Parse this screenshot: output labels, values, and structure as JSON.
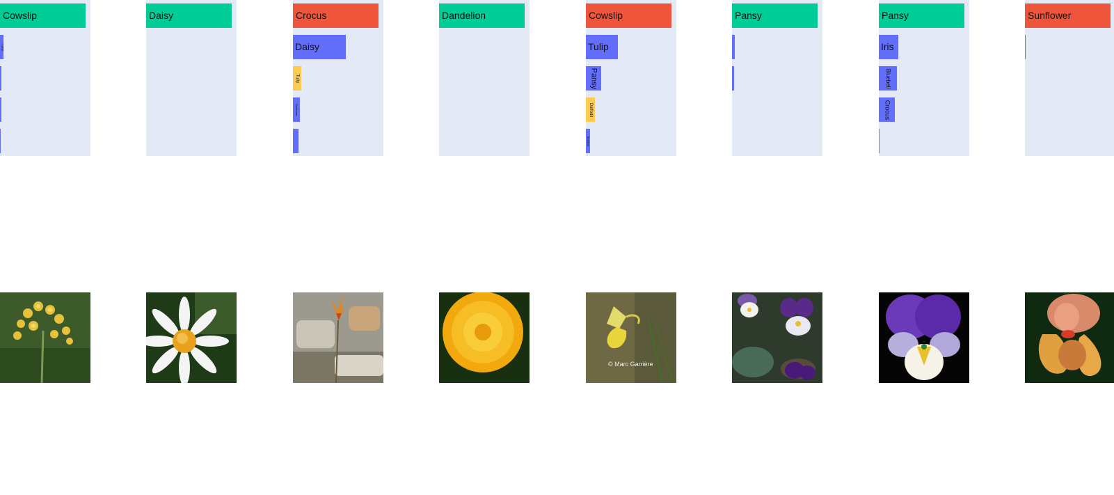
{
  "columns": [
    {
      "top": {
        "label": "Cowslip",
        "color": "#00cc96"
      },
      "bars": [
        {
          "label": "Tulip",
          "color": "#636efa"
        },
        {
          "label": "",
          "color": "#636efa"
        },
        {
          "label": "",
          "color": "#636efa"
        },
        {
          "label": "",
          "color": "#636efa"
        }
      ],
      "photo": "cowslip-photo"
    },
    {
      "top": {
        "label": "Daisy",
        "color": "#00cc96"
      },
      "bars": [],
      "photo": "daisy-photo"
    },
    {
      "top": {
        "label": "Crocus",
        "color": "#ef553b"
      },
      "bars": [
        {
          "label": "Daisy",
          "color": "#636efa"
        },
        {
          "label": "Tulip",
          "color": "#fecb52"
        },
        {
          "label": "Sunflower",
          "color": "#636efa"
        },
        {
          "label": "",
          "color": "#636efa"
        }
      ],
      "photo": "crocus-photo"
    },
    {
      "top": {
        "label": "Dandelion",
        "color": "#00cc96"
      },
      "bars": [],
      "photo": "dandelion-photo"
    },
    {
      "top": {
        "label": "Cowslip",
        "color": "#ef553b"
      },
      "bars": [
        {
          "label": "Tulip",
          "color": "#636efa"
        },
        {
          "label": "Pansy",
          "color": "#636efa"
        },
        {
          "label": "Daffodil",
          "color": "#fecb52"
        },
        {
          "label": "Bluebell",
          "color": "#636efa"
        }
      ],
      "photo": "daffodil-photo",
      "photo_caption": "© Marc Garrière"
    },
    {
      "top": {
        "label": "Pansy",
        "color": "#00cc96"
      },
      "bars": [
        {
          "label": "",
          "color": "#636efa"
        },
        {
          "label": "",
          "color": "#636efa"
        }
      ],
      "photo": "pansy-photo"
    },
    {
      "top": {
        "label": "Pansy",
        "color": "#00cc96"
      },
      "bars": [
        {
          "label": "Iris",
          "color": "#636efa"
        },
        {
          "label": "Bluebell",
          "color": "#636efa"
        },
        {
          "label": "Crocus",
          "color": "#636efa"
        },
        {
          "label": "",
          "color": "#636efa"
        }
      ],
      "photo": "pansy-photo-2"
    },
    {
      "top": {
        "label": "Sunflower",
        "color": "#ef553b"
      },
      "bars": [],
      "photo": "iris-photo"
    }
  ]
}
